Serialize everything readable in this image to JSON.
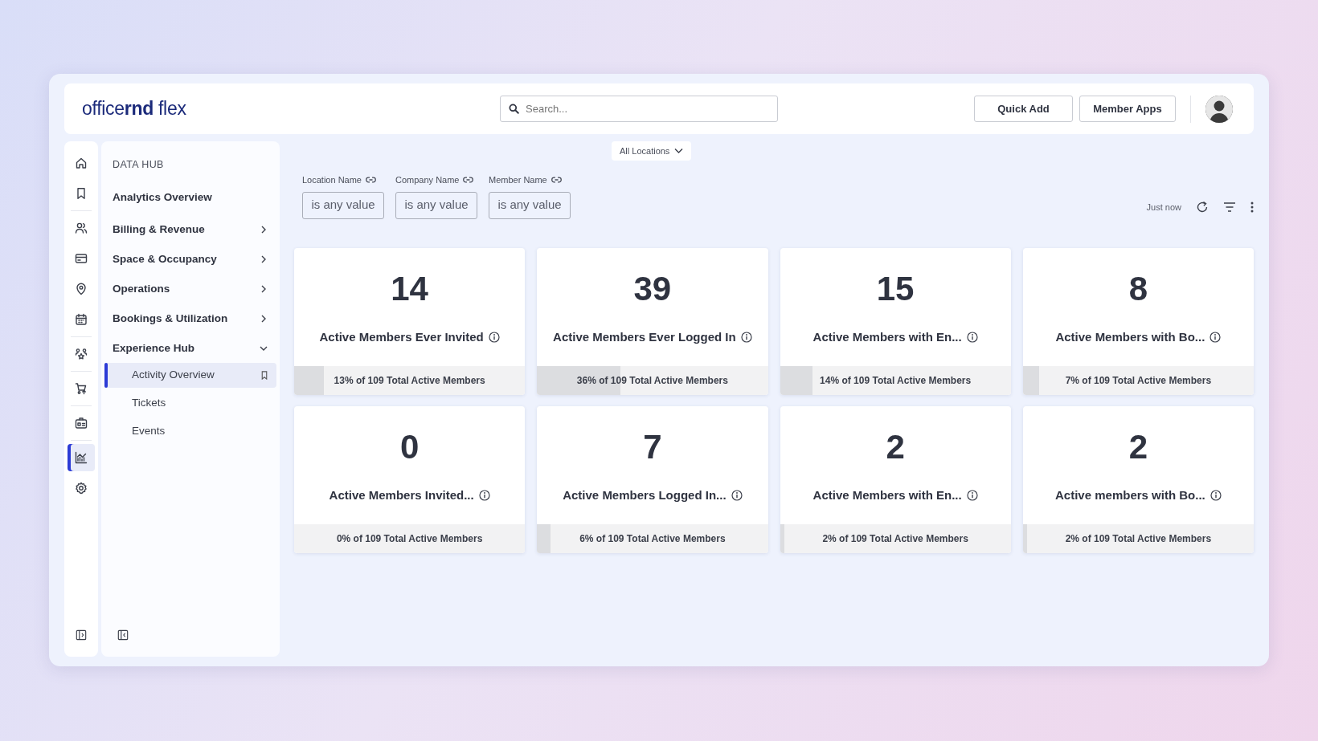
{
  "header": {
    "logo": "office**rnd** flex",
    "search": {
      "placeholder": "Search..."
    },
    "buttons": [
      "Quick Add",
      "Member Apps"
    ]
  },
  "icon_rail": [
    {
      "kind": "home",
      "selected": false
    },
    {
      "kind": "bookmark",
      "selected": false
    },
    {
      "kind": "people",
      "selected": false
    },
    {
      "kind": "card",
      "selected": false
    },
    {
      "kind": "pin",
      "selected": false
    },
    {
      "kind": "calendar",
      "selected": false
    },
    {
      "kind": "community",
      "selected": false
    },
    {
      "kind": "cart",
      "selected": false
    },
    {
      "kind": "badge",
      "selected": false
    },
    {
      "kind": "chart",
      "selected": true
    },
    {
      "kind": "gear",
      "selected": false
    }
  ],
  "nav": {
    "section_title": "DATA HUB",
    "items": [
      {
        "label": "Analytics Overview",
        "kind": "link"
      },
      {
        "label": "Billing & Revenue",
        "kind": "group",
        "expanded": false
      },
      {
        "label": "Space & Occupancy",
        "kind": "group",
        "expanded": false
      },
      {
        "label": "Operations",
        "kind": "group",
        "expanded": false
      },
      {
        "label": "Bookings & Utilization",
        "kind": "group",
        "expanded": false
      },
      {
        "label": "Experience Hub",
        "kind": "group",
        "expanded": true,
        "children": [
          {
            "label": "Activity Overview",
            "selected": true
          },
          {
            "label": "Tickets",
            "selected": false
          },
          {
            "label": "Events",
            "selected": false
          }
        ]
      }
    ]
  },
  "location_filter": "All Locations",
  "filters": [
    {
      "label": "Location Name",
      "value": "is any value"
    },
    {
      "label": "Company Name",
      "value": "is any value"
    },
    {
      "label": "Member Name",
      "value": "is any value"
    }
  ],
  "refresh_status": "Just now",
  "metrics": [
    {
      "value": "14",
      "title": "Active Members Ever Invited",
      "footer": "13% of 109 Total Active Members",
      "level": 0.13
    },
    {
      "value": "39",
      "title": "Active Members Ever Logged In",
      "footer": "36% of 109 Total Active Members",
      "level": 0.36
    },
    {
      "value": "15",
      "title": "Active Members with En...",
      "footer": "14% of 109 Total Active Members",
      "level": 0.14
    },
    {
      "value": "8",
      "title": "Active Members with Bo...",
      "footer": "7% of 109 Total Active Members",
      "level": 0.07
    },
    {
      "value": "0",
      "title": "Active Members Invited...",
      "footer": "0% of 109 Total Active Members",
      "level": 0
    },
    {
      "value": "7",
      "title": "Active Members Logged In...",
      "footer": "6% of 109 Total Active Members",
      "level": 0.06
    },
    {
      "value": "2",
      "title": "Active Members with En...",
      "footer": "2% of 109 Total Active Members",
      "level": 0.02
    },
    {
      "value": "2",
      "title": "Active members with Bo...",
      "footer": "2% of 109 Total Active Members",
      "level": 0.02
    }
  ]
}
